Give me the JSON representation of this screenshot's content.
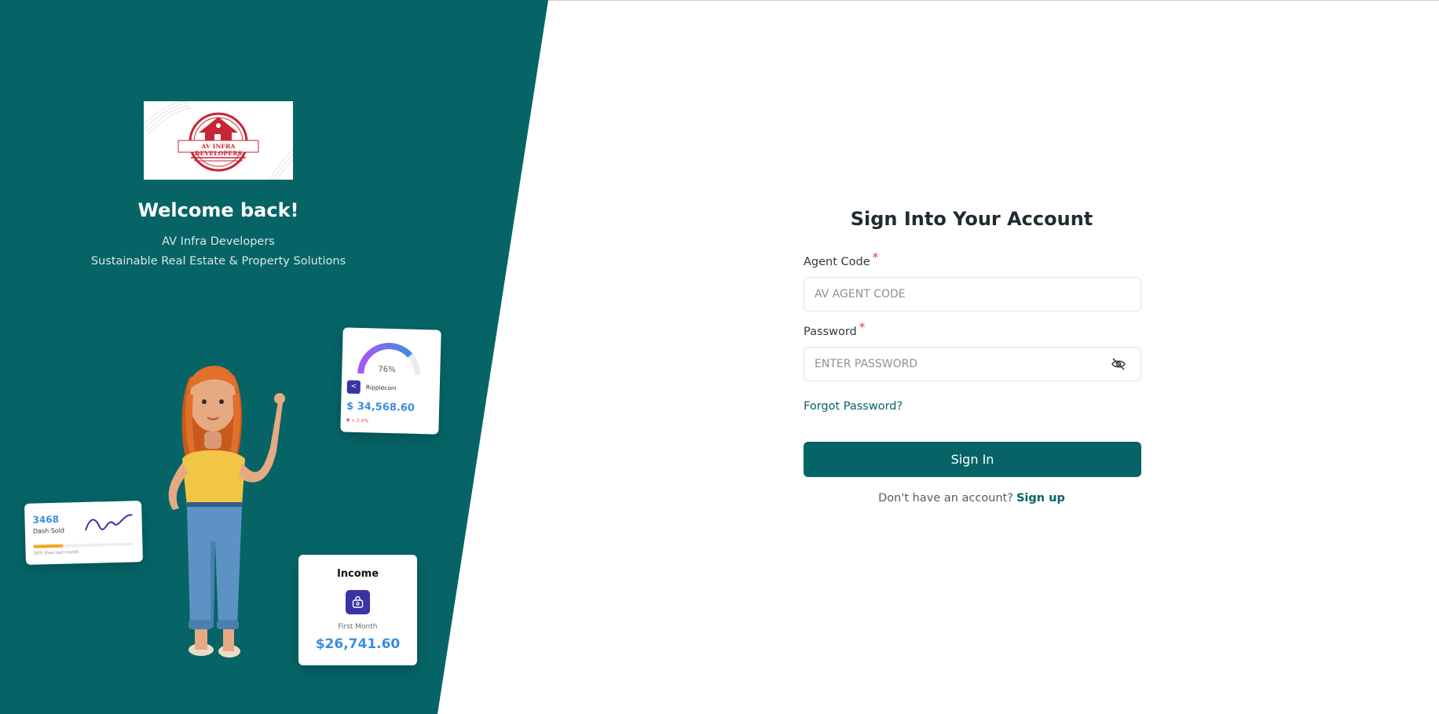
{
  "brand": {
    "logo_text": "AV INFRA DEVELOPERS",
    "welcome": "Welcome back!",
    "company": "AV Infra Developers",
    "tagline": "Sustainable Real Estate & Property Solutions"
  },
  "illustration": {
    "ripple_card": {
      "gauge_percent": "76%",
      "gauge_value": 0.76,
      "coin_name": "Ripplecoin",
      "price": "$ 34,568.60",
      "change": "+ 2.0%"
    },
    "dash_card": {
      "value": "3468",
      "label": "Dash Sold",
      "progress": 0.3,
      "footnote": "30% than last month"
    },
    "income_card": {
      "title": "Income",
      "label": "First Month",
      "value": "$26,741.60"
    },
    "icons": [
      "share-icon",
      "bag-icon",
      "eye-off-icon"
    ]
  },
  "form": {
    "title": "Sign Into Your Account",
    "agent_code_label": "Agent Code",
    "agent_code_placeholder": "AV AGENT CODE",
    "password_label": "Password",
    "password_placeholder": "ENTER PASSWORD",
    "required_mark": "*",
    "forgot_password": "Forgot Password?",
    "sign_in": "Sign In",
    "no_account": "Don't have an account?",
    "sign_up": "Sign up"
  },
  "colors": {
    "primary": "#066466",
    "accent_blue": "#3b8de0",
    "required": "#e53935",
    "indigo": "#3a33a8"
  }
}
